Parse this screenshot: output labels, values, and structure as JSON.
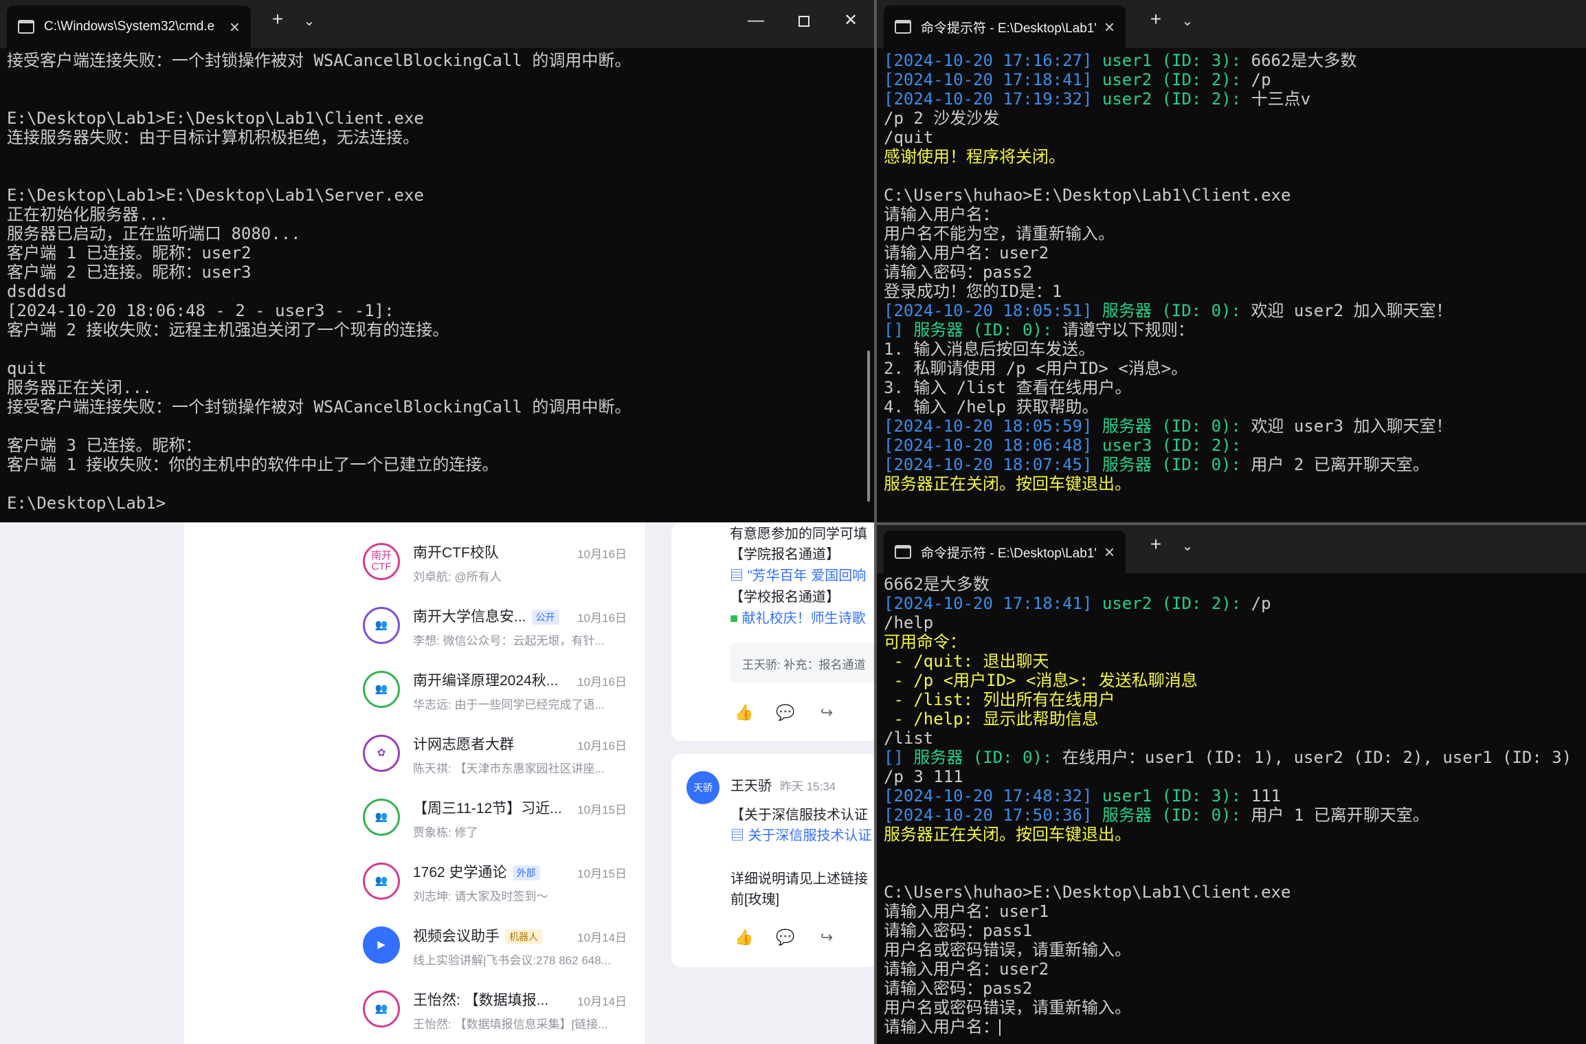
{
  "window_left": {
    "tab_title": "C:\\Windows\\System32\\cmd.e",
    "lines": [
      [
        [
          "w",
          "接受客户端连接失败：一个封锁操作被对 WSACancelBlockingCall 的调用中断。"
        ]
      ],
      [
        [
          "w",
          ""
        ]
      ],
      [
        [
          "w",
          ""
        ]
      ],
      [
        [
          "w",
          "E:\\Desktop\\Lab1>E:\\Desktop\\Lab1\\Client.exe"
        ]
      ],
      [
        [
          "w",
          "连接服务器失败：由于目标计算机积极拒绝，无法连接。"
        ]
      ],
      [
        [
          "w",
          ""
        ]
      ],
      [
        [
          "w",
          ""
        ]
      ],
      [
        [
          "w",
          "E:\\Desktop\\Lab1>E:\\Desktop\\Lab1\\Server.exe"
        ]
      ],
      [
        [
          "w",
          "正在初始化服务器..."
        ]
      ],
      [
        [
          "w",
          "服务器已启动，正在监听端口 8080..."
        ]
      ],
      [
        [
          "w",
          "客户端 1 已连接。昵称：user2"
        ]
      ],
      [
        [
          "w",
          "客户端 2 已连接。昵称：user3"
        ]
      ],
      [
        [
          "w",
          "dsddsd"
        ]
      ],
      [
        [
          "w",
          "[2024-10-20 18:06:48 - 2 - user3 - -1]:"
        ]
      ],
      [
        [
          "w",
          "客户端 2 接收失败：远程主机强迫关闭了一个现有的连接。"
        ]
      ],
      [
        [
          "w",
          ""
        ]
      ],
      [
        [
          "w",
          "quit"
        ]
      ],
      [
        [
          "w",
          "服务器正在关闭..."
        ]
      ],
      [
        [
          "w",
          "接受客户端连接失败：一个封锁操作被对 WSACancelBlockingCall 的调用中断。"
        ]
      ],
      [
        [
          "w",
          ""
        ]
      ],
      [
        [
          "w",
          "客户端 3 已连接。昵称："
        ]
      ],
      [
        [
          "w",
          "客户端 1 接收失败：你的主机中的软件中止了一个已建立的连接。"
        ]
      ],
      [
        [
          "w",
          ""
        ]
      ],
      [
        [
          "w",
          "E:\\Desktop\\Lab1>"
        ]
      ]
    ]
  },
  "window_top_right": {
    "tab_title": "命令提示符 - E:\\Desktop\\Lab1'",
    "lines": [
      [
        [
          "b",
          "[2024-10-20 17:16:27] "
        ],
        [
          "g",
          "user1 (ID: 3): "
        ],
        [
          "w",
          "6662是大多数"
        ]
      ],
      [
        [
          "b",
          "[2024-10-20 17:18:41] "
        ],
        [
          "g",
          "user2 (ID: 2): "
        ],
        [
          "w",
          "/p"
        ]
      ],
      [
        [
          "b",
          "[2024-10-20 17:19:32] "
        ],
        [
          "g",
          "user2 (ID: 2): "
        ],
        [
          "w",
          "十三点v"
        ]
      ],
      [
        [
          "w",
          "/p 2 沙发沙发"
        ]
      ],
      [
        [
          "w",
          "/quit"
        ]
      ],
      [
        [
          "y",
          "感谢使用！程序将关闭。"
        ]
      ],
      [
        [
          "w",
          ""
        ]
      ],
      [
        [
          "w",
          "C:\\Users\\huhao>E:\\Desktop\\Lab1\\Client.exe"
        ]
      ],
      [
        [
          "w",
          "请输入用户名："
        ]
      ],
      [
        [
          "w",
          "用户名不能为空，请重新输入。"
        ]
      ],
      [
        [
          "w",
          "请输入用户名：user2"
        ]
      ],
      [
        [
          "w",
          "请输入密码：pass2"
        ]
      ],
      [
        [
          "w",
          "登录成功！您的ID是：1"
        ]
      ],
      [
        [
          "b",
          "[2024-10-20 18:05:51] "
        ],
        [
          "g",
          "服务器 (ID: 0): "
        ],
        [
          "w",
          "欢迎 user2 加入聊天室！"
        ]
      ],
      [
        [
          "b",
          "[] "
        ],
        [
          "g",
          "服务器 (ID: 0): "
        ],
        [
          "w",
          "请遵守以下规则："
        ]
      ],
      [
        [
          "w",
          "1. 输入消息后按回车发送。"
        ]
      ],
      [
        [
          "w",
          "2. 私聊请使用 /p <用户ID> <消息>。"
        ]
      ],
      [
        [
          "w",
          "3. 输入 /list 查看在线用户。"
        ]
      ],
      [
        [
          "w",
          "4. 输入 /help 获取帮助。"
        ]
      ],
      [
        [
          "b",
          "[2024-10-20 18:05:59] "
        ],
        [
          "g",
          "服务器 (ID: 0): "
        ],
        [
          "w",
          "欢迎 user3 加入聊天室！"
        ]
      ],
      [
        [
          "b",
          "[2024-10-20 18:06:48] "
        ],
        [
          "g",
          "user3 (ID: 2):"
        ]
      ],
      [
        [
          "b",
          "[2024-10-20 18:07:45] "
        ],
        [
          "g",
          "服务器 (ID: 0): "
        ],
        [
          "w",
          "用户 2 已离开聊天室。"
        ]
      ],
      [
        [
          "y",
          "服务器正在关闭。按回车键退出。"
        ]
      ]
    ]
  },
  "window_bottom_right": {
    "tab_title": "命令提示符 - E:\\Desktop\\Lab1'",
    "lines": [
      [
        [
          "w",
          "6662是大多数"
        ]
      ],
      [
        [
          "b",
          "[2024-10-20 17:18:41] "
        ],
        [
          "g",
          "user2 (ID: 2): "
        ],
        [
          "w",
          "/p"
        ]
      ],
      [
        [
          "w",
          "/help"
        ]
      ],
      [
        [
          "y",
          "可用命令："
        ]
      ],
      [
        [
          "y",
          " - /quit: 退出聊天"
        ]
      ],
      [
        [
          "y",
          " - /p <用户ID> <消息>: 发送私聊消息"
        ]
      ],
      [
        [
          "y",
          " - /list: 列出所有在线用户"
        ]
      ],
      [
        [
          "y",
          " - /help: 显示此帮助信息"
        ]
      ],
      [
        [
          "w",
          "/list"
        ]
      ],
      [
        [
          "b",
          "[] "
        ],
        [
          "g",
          "服务器 (ID: 0): "
        ],
        [
          "w",
          "在线用户：user1 (ID: 1), user2 (ID: 2), user1 (ID: 3)"
        ]
      ],
      [
        [
          "w",
          "/p 3 111"
        ]
      ],
      [
        [
          "b",
          "[2024-10-20 17:48:32] "
        ],
        [
          "g",
          "user1 (ID: 3): "
        ],
        [
          "w",
          "111"
        ]
      ],
      [
        [
          "b",
          "[2024-10-20 17:50:36] "
        ],
        [
          "g",
          "服务器 (ID: 0): "
        ],
        [
          "w",
          "用户 1 已离开聊天室。"
        ]
      ],
      [
        [
          "y",
          "服务器正在关闭。按回车键退出。"
        ]
      ],
      [
        [
          "w",
          ""
        ]
      ],
      [
        [
          "w",
          ""
        ]
      ],
      [
        [
          "w",
          "C:\\Users\\huhao>E:\\Desktop\\Lab1\\Client.exe"
        ]
      ],
      [
        [
          "w",
          "请输入用户名：user1"
        ]
      ],
      [
        [
          "w",
          "请输入密码：pass1"
        ]
      ],
      [
        [
          "w",
          "用户名或密码错误，请重新输入。"
        ]
      ],
      [
        [
          "w",
          "请输入用户名：user2"
        ]
      ],
      [
        [
          "w",
          "请输入密码：pass2"
        ]
      ],
      [
        [
          "w",
          "用户名或密码错误，请重新输入。"
        ]
      ],
      [
        [
          "w",
          "请输入用户名："
        ]
      ]
    ]
  },
  "chat_list": [
    {
      "avatar": "南开 CTF",
      "avatar_icon": "text",
      "color": "#d63b8f",
      "title": "南开CTF校队",
      "badge": "",
      "date": "10月16日",
      "preview": "刘卓航: @所有人"
    },
    {
      "avatar": "",
      "avatar_icon": "group-icon",
      "color": "#7b4fd6",
      "title": "南开大学信息安...",
      "badge": "公开",
      "badge_style": "blue",
      "date": "10月16日",
      "preview": "李想: 微信公众号：云起无垠，有针..."
    },
    {
      "avatar": "",
      "avatar_icon": "group-icon",
      "color": "#34b34f",
      "title": "南开编译原理2024秋...",
      "badge": "",
      "date": "10月16日",
      "preview": "华志远: 由于一些同学已经完成了语..."
    },
    {
      "avatar": "",
      "avatar_icon": "image-icon",
      "color": "#9b3fb5",
      "title": "计网志愿者大群",
      "badge": "",
      "date": "10月16日",
      "preview": "陈天祺: 【天津市东惠家园社区讲座..."
    },
    {
      "avatar": "",
      "avatar_icon": "group-icon",
      "color": "#34b34f",
      "title": "【周三11-12节】习近...",
      "badge": "",
      "date": "10月15日",
      "preview": "贾象栋: 修了"
    },
    {
      "avatar": "",
      "avatar_icon": "group-icon",
      "color": "#d63b8f",
      "title": "1762 史学通论",
      "badge": "外部",
      "badge_style": "blue",
      "date": "10月15日",
      "preview": "刘志坤: 请大家及时签到～"
    },
    {
      "avatar": "",
      "avatar_icon": "video-icon",
      "color": "#3370ff",
      "title": "视频会议助手",
      "badge": "机器人",
      "badge_style": "yellow",
      "date": "10月14日",
      "preview": "线上实验讲解|飞书会议:278 862 648..."
    },
    {
      "avatar": "",
      "avatar_icon": "group-icon",
      "color": "#d63b8f",
      "title": "王怡然: 【数据填报...",
      "badge": "",
      "date": "10月14日",
      "preview": "王怡然: 【数据填报信息采集】[链接..."
    }
  ],
  "feed": {
    "card1": {
      "line1": "有意愿参加的同学可填",
      "line2": "【学院报名通道】",
      "link1": "\"芳华百年 爱国回响",
      "line3": "【学校报名通道】",
      "link2": "献礼校庆！师生诗歌",
      "reply": "王天骄: 补充：报名通道"
    },
    "card2": {
      "avatar": "天骄",
      "author": "王天骄",
      "time": "昨天 15:34",
      "line1": "【关于深信服技术认证",
      "link1": "关于深信服技术认证",
      "line2": "详细说明请见上述链接",
      "line3": "前[玫瑰]"
    }
  },
  "colors": {
    "blue": "#3b8eea",
    "green": "#23d18b",
    "yellow": "#f5f543",
    "white": "#cccccc",
    "terminal_bg": "#0c0c0c",
    "titlebar_bg": "#202020"
  }
}
